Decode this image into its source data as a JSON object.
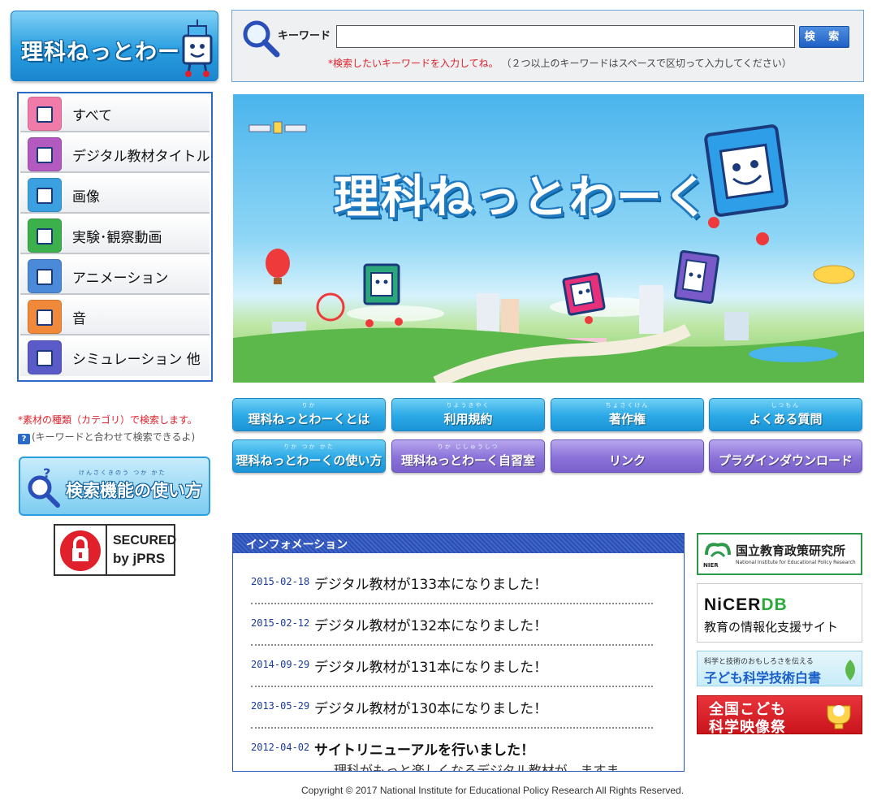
{
  "logo": {
    "text": "理科ねっとわーく"
  },
  "search": {
    "label": "キーワード",
    "value": "",
    "button_label": "検 索",
    "note_red": "*検索したいキーワードを入力してね。",
    "note_gray": "（２つ以上のキーワードはスペースで区切って入力してください）"
  },
  "categories": [
    {
      "label": "すべて",
      "icon": "all-icon",
      "color": "#f07aa8"
    },
    {
      "label": "デジタル教材タイトル",
      "icon": "digital-title-icon",
      "color": "#b25ac0"
    },
    {
      "label": "画像",
      "icon": "image-icon",
      "color": "#3aa0e0"
    },
    {
      "label": "実験･観察動画",
      "icon": "video-icon",
      "color": "#3cb04a"
    },
    {
      "label": "アニメーション",
      "icon": "animation-icon",
      "color": "#4a8ad8"
    },
    {
      "label": "音",
      "icon": "sound-icon",
      "color": "#f08a3a"
    },
    {
      "label": "シミュレーション 他",
      "icon": "simulation-icon",
      "color": "#5a5ac8"
    }
  ],
  "category_note": {
    "red": "*素材の種類（カテゴリ）で検索します。",
    "gray": "(キーワードと合わせて検索できるよ)"
  },
  "howto_search": {
    "label": "検索機能の使い方",
    "ruby": "けんさくきのう つか かた"
  },
  "secured": {
    "line1": "SECURED",
    "line2": "by jPRS"
  },
  "banner": {
    "title": "理科ねっとわーく"
  },
  "nav": [
    {
      "label": "理科ねっとわーくとは",
      "ruby": "りか",
      "style": "blue"
    },
    {
      "label": "利用規約",
      "ruby": "りようきやく",
      "style": "blue"
    },
    {
      "label": "著作権",
      "ruby": "ちょさくけん",
      "style": "blue"
    },
    {
      "label": "よくある質問",
      "ruby": "しつもん",
      "style": "blue"
    },
    {
      "label": "理科ねっとわーくの使い方",
      "ruby": "りか つか かた",
      "style": "blue"
    },
    {
      "label": "理科ねっとわーく自習室",
      "ruby": "りか じしゅうしつ",
      "style": "purple"
    },
    {
      "label": "リンク",
      "ruby": "",
      "style": "purple"
    },
    {
      "label": "プラグインダウンロード",
      "ruby": "",
      "style": "purple"
    }
  ],
  "info": {
    "header": "インフォメーション",
    "items": [
      {
        "date": "2015-02-18",
        "title": "デジタル教材が133本になりました！"
      },
      {
        "date": "2015-02-12",
        "title": "デジタル教材が132本になりました！"
      },
      {
        "date": "2014-09-29",
        "title": "デジタル教材が131本になりました！"
      },
      {
        "date": "2013-05-29",
        "title": "デジタル教材が130本になりました！"
      },
      {
        "date": "2012-04-02",
        "title": "サイトリニューアルを行いました！",
        "desc": "理科がもっと楽しくなるデジタル教材が、ますま"
      }
    ]
  },
  "badges": {
    "nier_name": "国立教育政策研究所",
    "nier_en": "National Institute for Educational Policy Research",
    "nier_abbr": "NIER",
    "nicer_a": "NiCER",
    "nicer_b": "DB",
    "nicer_sub": "教育の情報化支援サイト",
    "kodomo_sub": "科学と技術のおもしろさを伝える",
    "kodomo_title": "子ども科学技術白書",
    "eiga_1": "全国こども",
    "eiga_2": "科学映像祭"
  },
  "footer": "Copyright © 2017 National Institute for Educational Policy Research All Rights Reserved."
}
